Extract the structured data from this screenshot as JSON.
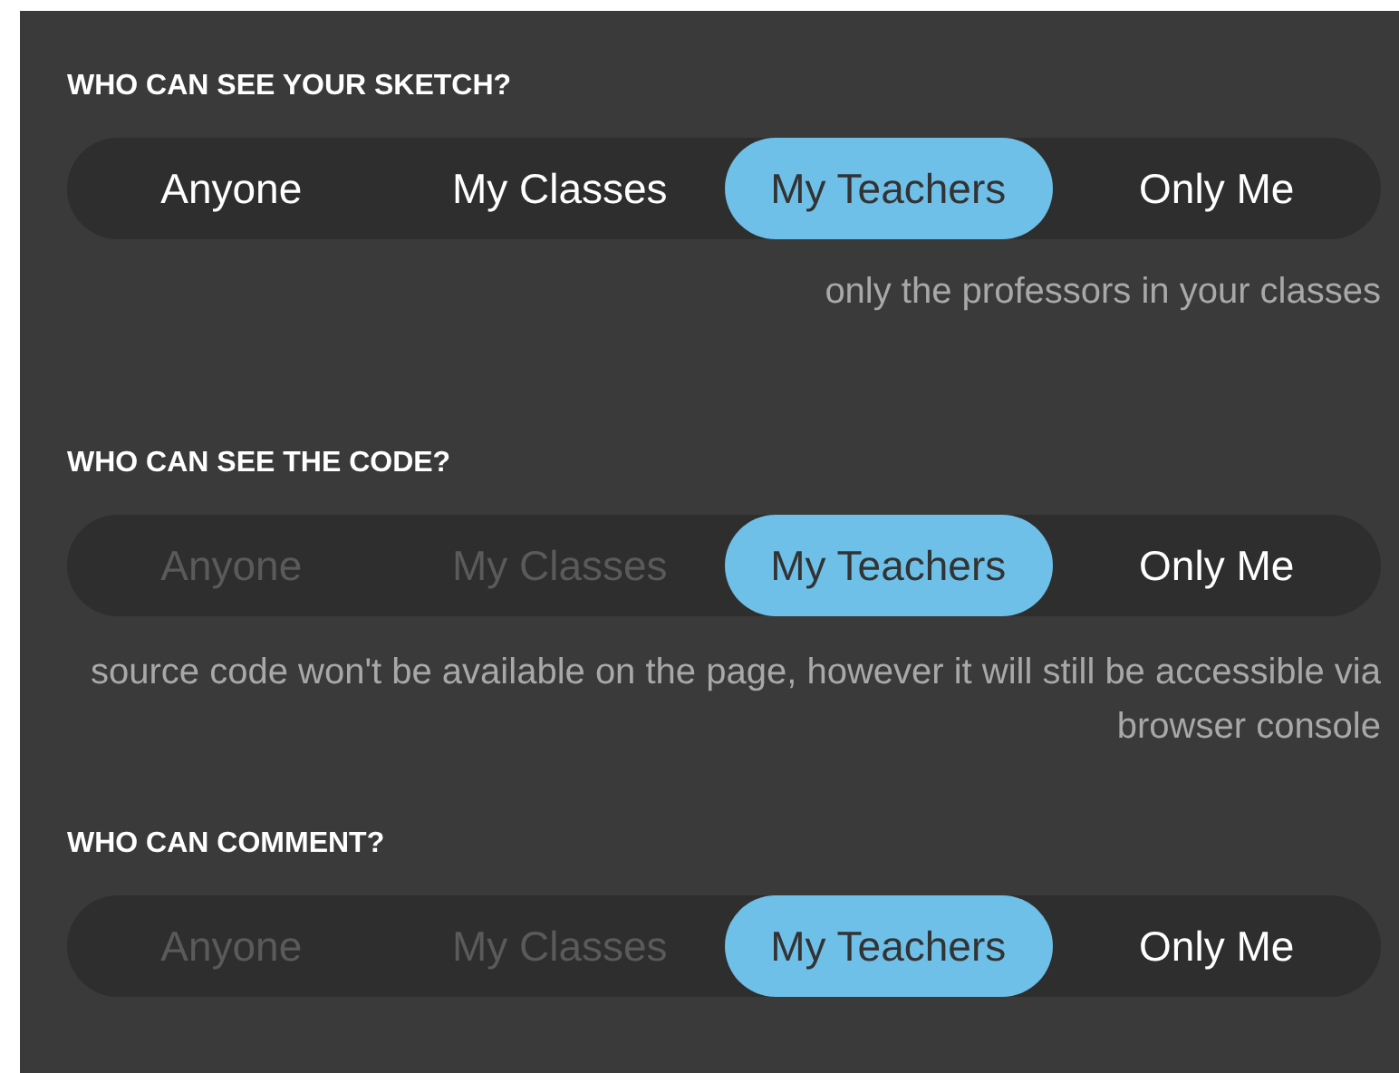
{
  "sections": [
    {
      "title": "WHO CAN SEE YOUR SKETCH?",
      "options": [
        {
          "label": "Anyone",
          "selected": false,
          "disabled": false
        },
        {
          "label": "My Classes",
          "selected": false,
          "disabled": false
        },
        {
          "label": "My Teachers",
          "selected": true,
          "disabled": false
        },
        {
          "label": "Only Me",
          "selected": false,
          "disabled": false
        }
      ],
      "hint": "only the professors in your classes"
    },
    {
      "title": "WHO CAN SEE THE CODE?",
      "options": [
        {
          "label": "Anyone",
          "selected": false,
          "disabled": true
        },
        {
          "label": "My Classes",
          "selected": false,
          "disabled": true
        },
        {
          "label": "My Teachers",
          "selected": true,
          "disabled": false
        },
        {
          "label": "Only Me",
          "selected": false,
          "disabled": false
        }
      ],
      "hint": "source code won't be available on the page, however it will still be accessible via browser console"
    },
    {
      "title": "WHO CAN COMMENT?",
      "options": [
        {
          "label": "Anyone",
          "selected": false,
          "disabled": true
        },
        {
          "label": "My Classes",
          "selected": false,
          "disabled": true
        },
        {
          "label": "My Teachers",
          "selected": true,
          "disabled": false
        },
        {
          "label": "Only Me",
          "selected": false,
          "disabled": false
        }
      ]
    }
  ]
}
